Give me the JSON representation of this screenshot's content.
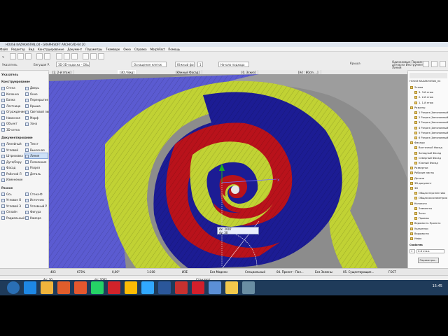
{
  "window": {
    "title": "HOUSE KAZAKHSTAN_04 - GRAPHISOFT ARCHICAD-64 20"
  },
  "menu": [
    "Файл",
    "Редактор",
    "Вид",
    "Конструирование",
    "Документ",
    "Параметры",
    "Теамворк",
    "Окно",
    "Справка",
    "MorphFact",
    "Помощь"
  ],
  "toolbar": {
    "arrow_label": "Указатель",
    "select_label": "Бегущая Р.",
    "view_label": "3D-3D-подоска - Общий",
    "layer_label": "Оснащение клеток",
    "floor_label": "Южный фасад",
    "scale_value": "1",
    "tracker_label": "Начало подхода",
    "param_label": "Крыша",
    "check_label": "Одинаковые Параметры для всех Инструментов Линий"
  },
  "view_tabs": [
    "[2. 2-й этаж]",
    "[3D / Вид]",
    "[Южный Фасад]",
    "[0. Эскиз]",
    "[A4 : 80cm ...]"
  ],
  "left_panel": {
    "header": "Указатель",
    "sections": [
      {
        "title": "Конструирование",
        "tools": [
          "Стена",
          "Дверь",
          "Колонна",
          "Окно",
          "Балка",
          "Перекрытие",
          "Лестница",
          "Крыша",
          "Ограждение",
          "Световой люк",
          "Навесная",
          "Морф",
          "Объект",
          "Зона",
          "3D-сетка"
        ]
      },
      {
        "title": "Документирование",
        "tools": [
          "Линейный",
          "Текст",
          "Угловой",
          "Выносная",
          "Штриховка",
          "Линия",
          "Дуга/Окру",
          "Полилиния",
          "Фасад",
          "Разрез",
          "Рабочий Л",
          "Деталь",
          "Изменение"
        ]
      },
      {
        "title": "Разное",
        "tools": [
          "Ось",
          "Стена-Ф",
          "Угловое О",
          "Источник",
          "Угловой Э",
          "Условный Р",
          "Сплайн",
          "Фигура",
          "Радиальный",
          "Камера"
        ]
      }
    ],
    "selected_tool": "Линия"
  },
  "navigator": {
    "title": "HOUSE KAZAKHSTAN_04",
    "items": [
      "Этажи",
      "3. 3-й этаж",
      "2. 2-й этаж",
      "1. 1-й этаж",
      "Разрезы",
      "1 Разрез (Автономный)",
      "2 Разрез (Автономный)",
      "3 Разрез (Автономный)",
      "4 Разрез (Автономный)",
      "5 Разрез (Автономный)",
      "6 Разрез (Автономный)",
      "Фасады",
      "Восточный Фасад",
      "Западный Фасад",
      "Северный Фасад",
      "Южный Фасад",
      "Развертки",
      "Рабочие листы",
      "Детали",
      "3D-документ",
      "3D",
      "Общая перспектива",
      "Общая аксонометрия",
      "Каталоги",
      "Элементы",
      "Зоны",
      "Проемы",
      "Ведомость Проекта",
      "Указатели",
      "Ведомости",
      "Инфо"
    ],
    "bottom_label": "Свойства",
    "floor_value": "1",
    "floor_name": "2-й этаж",
    "params_button": "Параметры..."
  },
  "status": {
    "undo": "403",
    "zoom": "673%",
    "angle": "0,00°",
    "scale": "1:100",
    "pen": "ИЗЕ",
    "fill": "Без Модели",
    "layer": "Специальный",
    "renovation": "04. Проект - Пол...",
    "structure": "Без Замены",
    "model": "05. Существующие...",
    "paper": "ГОСТ"
  },
  "infobox": {
    "ax": "Ax: 20",
    "ay": "Ay: 123",
    "dx": "dx: 2002",
    "dy": "dy: 90,10°",
    "angle": "угл. Перпендику...",
    "ok": "OK",
    "cancel": "Отменить",
    "standard": "Стандарт"
  },
  "hint": "Укажите Местоположение Начальной Позиции Линии.",
  "tooltip": {
    "line1": "dx: 2007",
    "line2": "dy: 30"
  },
  "taskbar": {
    "time": "15:45",
    "icons": [
      "start-icon",
      "ie-icon",
      "explorer-icon",
      "media-icon",
      "firefox-icon",
      "whatsapp-icon",
      "opera-icon",
      "chrome-icon",
      "photoshop-icon",
      "word-icon",
      "archicad-icon",
      "autocad-icon",
      "notepad-icon",
      "files-icon",
      "app-icon"
    ]
  },
  "colors": {
    "blue": "#1c1c94",
    "red": "#b9121b",
    "yellow": "#c1d234",
    "purple": "#5b5bd1",
    "taskbar": "#1f3b5a"
  }
}
